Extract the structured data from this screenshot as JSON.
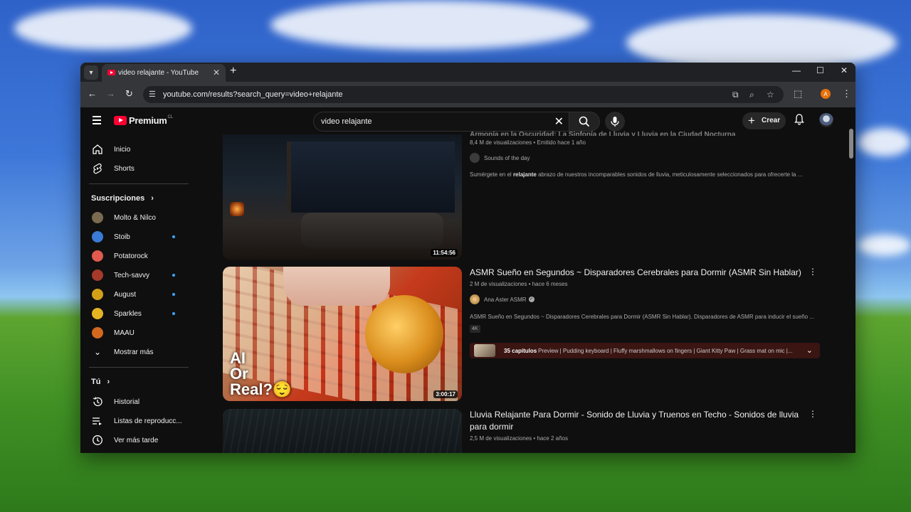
{
  "browser": {
    "tab_title": "video relajante - YouTube",
    "tab_close": "✕",
    "new_tab": "+",
    "url": "youtube.com/results?search_query=video+relajante",
    "profile_initial": "A",
    "window_controls": {
      "minimize": "—",
      "maximize": "☐",
      "close": "✕"
    }
  },
  "youtube": {
    "brand": "Premium",
    "region": "CL",
    "search_query": "video relajante",
    "create_label": "Crear",
    "sidebar": {
      "main": [
        {
          "label": "Inicio",
          "icon": "home-icon"
        },
        {
          "label": "Shorts",
          "icon": "shorts-icon"
        }
      ],
      "subscriptions_heading": "Suscripciones",
      "subscriptions": [
        {
          "label": "Molto & Nilco",
          "avatar_color": "#7a6a50",
          "new": false
        },
        {
          "label": "Stoib",
          "avatar_color": "#3a7bd5",
          "new": true
        },
        {
          "label": "Potatorock",
          "avatar_color": "#e05a4f",
          "new": false
        },
        {
          "label": "Tech-savvy",
          "avatar_color": "#a53a2a",
          "new": true
        },
        {
          "label": "August",
          "avatar_color": "#d4a017",
          "new": true
        },
        {
          "label": "Sparkles",
          "avatar_color": "#e6b422",
          "new": true
        },
        {
          "label": "MAAU",
          "avatar_color": "#d2691e",
          "new": false
        }
      ],
      "show_more": "Mostrar más",
      "you_heading": "Tú",
      "you_items": [
        {
          "label": "Historial",
          "icon": "history-icon"
        },
        {
          "label": "Listas de reproducc...",
          "icon": "playlist-icon"
        },
        {
          "label": "Ver más tarde",
          "icon": "watch-later-icon"
        }
      ]
    },
    "results": [
      {
        "title": "Armonía en la Oscuridad: La Sinfonía de Lluvia y Lluvia en la Ciudad Nocturna",
        "meta": "8,4 M de visualizaciones • Emitido hace 1 año",
        "channel": "Sounds of the day",
        "description_pre": "Sumérgete en el ",
        "description_bold": "relajante",
        "description_post": " abrazo de nuestros incomparables sonidos de lluvia, meticulosamente seleccionados para ofrecerte la ...",
        "duration": "11:54:56"
      },
      {
        "title": "ASMR Sueño en Segundos ~ Disparadores Cerebrales para Dormir (ASMR Sin Hablar)",
        "meta": "2 M de visualizaciones • hace 6 meses",
        "channel": "Ana Aster ASMR",
        "verified": true,
        "description": "ASMR Sueño en Segundos ~ Disparadores Cerebrales para Dormir (ASMR Sin Hablar). Disparadores de ASMR para inducir el sueño ...",
        "badge": "4K",
        "chapters_count": "35 capítulos",
        "chapters_text": "Preview | Pudding keyboard | Fluffy marshmallows on fingers | Giant Kitty Paw | Grass mat on mic |...",
        "duration": "3:00:17",
        "thumb_text_1": "AI",
        "thumb_text_2": "Or",
        "thumb_text_3": "Real?😌"
      },
      {
        "title": "Lluvia Relajante Para Dormir - Sonido de Lluvia y Truenos en Techo - Sonidos de lluvia para dormir",
        "meta": "2,5 M de visualizaciones • hace 2 años"
      }
    ]
  }
}
